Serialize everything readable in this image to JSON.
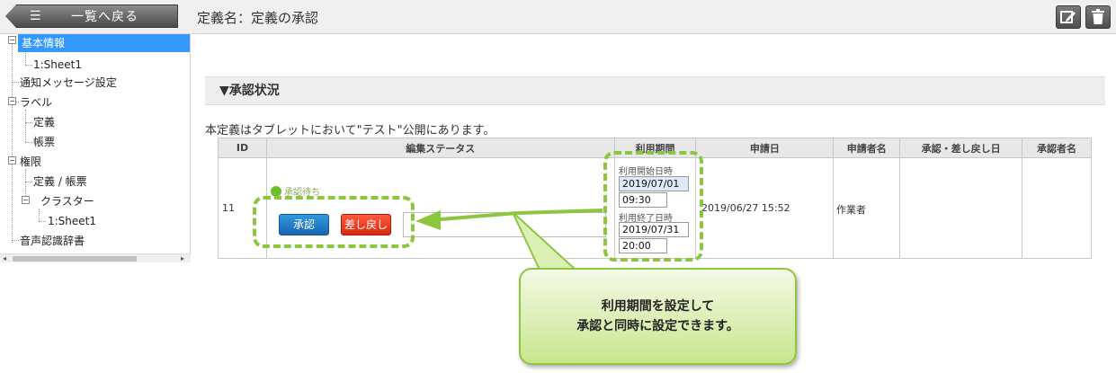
{
  "header": {
    "back_label": "一覧へ戻る",
    "list_icon": "☰",
    "title": "定義名：定義の承認",
    "edit_icon": "edit-icon",
    "delete_icon": "trash-icon"
  },
  "sidebar": {
    "items": [
      {
        "label": "基本情報",
        "selected": true
      },
      {
        "label": "1:Sheet1"
      },
      {
        "label": "通知メッセージ設定"
      },
      {
        "label": "ラベル"
      },
      {
        "label": "定義"
      },
      {
        "label": "帳票"
      },
      {
        "label": "権限"
      },
      {
        "label": "定義 / 帳票"
      },
      {
        "label": "クラスター"
      },
      {
        "label": "1:Sheet1"
      },
      {
        "label": "音声認識辞書"
      }
    ]
  },
  "section": {
    "title": "▼承認状況",
    "notice": "本定義はタブレットにおいて\"テスト\"公開にあります。"
  },
  "table": {
    "headers": [
      "ID",
      "編集ステータス",
      "利用期間",
      "申請日",
      "申請者名",
      "承認・差し戻し日",
      "承認者名"
    ],
    "row": {
      "id": "11",
      "status": "承認待ち",
      "approve_label": "承認",
      "reject_label": "差し戻し",
      "start_label": "利用開始日時",
      "start_date": "2019/07/01",
      "start_time": "09:30",
      "end_label": "利用終了日時",
      "end_date": "2019/07/31",
      "end_time": "20:00",
      "applied_date": "2019/06/27 15:52",
      "applicant": "作業者",
      "approval_date": "",
      "approver": ""
    }
  },
  "callout": {
    "line1": "利用期間を設定して",
    "line2": "承認と同時に設定できます。"
  },
  "colors": {
    "accent_green": "#8cc63f",
    "selected_blue": "#3399ff",
    "approve_blue": "#1a64b0",
    "reject_red": "#d82a10"
  }
}
